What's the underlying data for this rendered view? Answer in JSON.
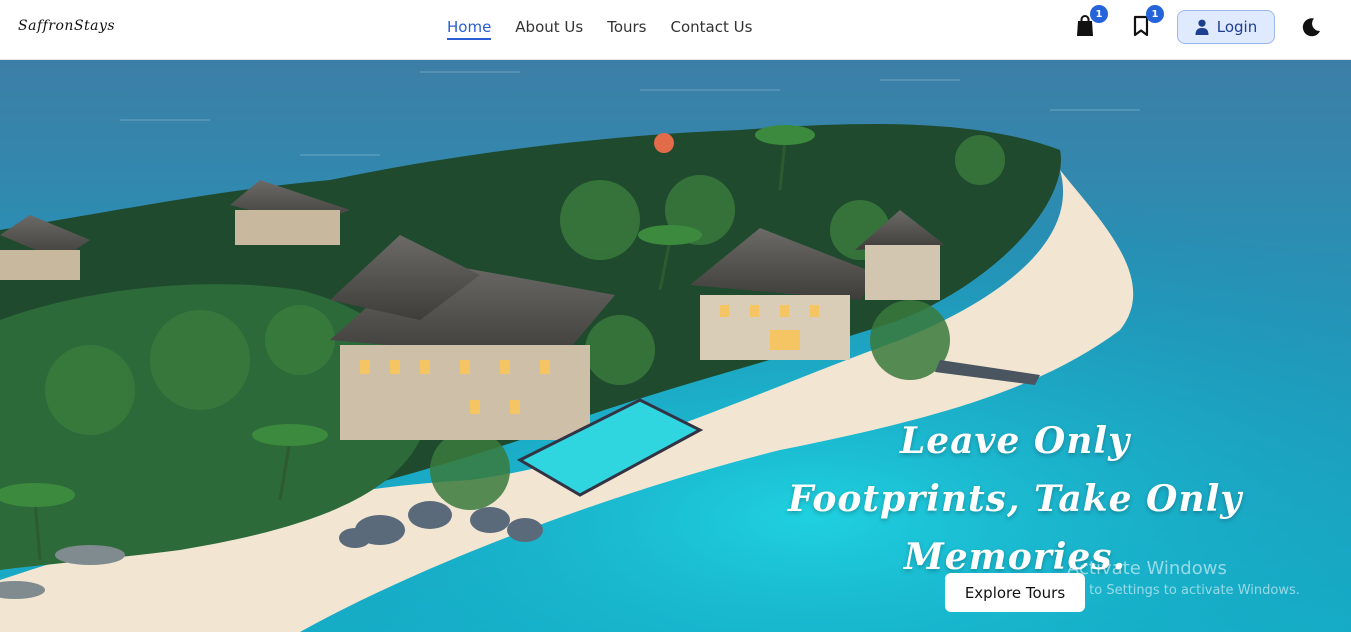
{
  "brand": {
    "logo_text": "SaffronStays"
  },
  "nav": {
    "items": [
      {
        "label": "Home",
        "active": true
      },
      {
        "label": "About Us",
        "active": false
      },
      {
        "label": "Tours",
        "active": false
      },
      {
        "label": "Contact Us",
        "active": false
      }
    ]
  },
  "header_actions": {
    "cart_icon": "shopping-bag-icon",
    "cart_count": "1",
    "bookmark_icon": "bookmark-icon",
    "bookmark_count": "1",
    "login_icon": "user-icon",
    "login_label": "Login",
    "theme_icon": "moon-icon"
  },
  "hero": {
    "tagline": "Leave Only Footprints, Take Only Memories.",
    "cta_label": "Explore Tours"
  },
  "os_watermark": {
    "line1": "Activate Windows",
    "line2": "Go to Settings to activate Windows."
  },
  "colors": {
    "accent": "#2a5cd6",
    "badge": "#2463d9",
    "login_bg": "#dfeaff",
    "sea": "#1aa9c4"
  }
}
